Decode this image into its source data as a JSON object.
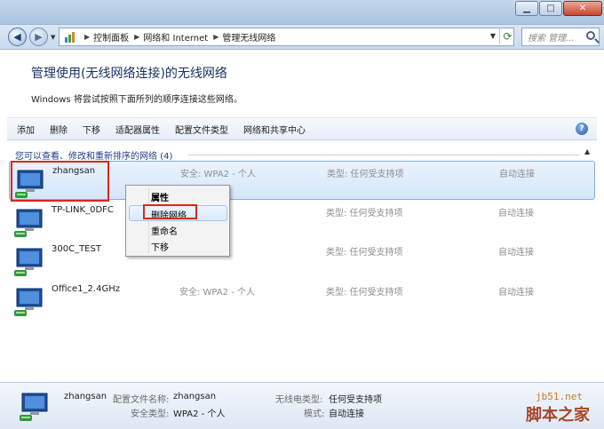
{
  "window": {
    "min_glyph": "▁",
    "max_glyph": "□",
    "close_glyph": "✕"
  },
  "address": {
    "crumbs": [
      "控制面板",
      "网络和 Internet",
      "管理无线网络"
    ],
    "search_placeholder": "搜索 管理..."
  },
  "header": {
    "title": "管理使用(无线网络连接)的无线网络",
    "description": "Windows 将尝试按照下面所列的顺序连接这些网络。"
  },
  "toolbar": {
    "items": [
      "添加",
      "删除",
      "下移",
      "适配器属性",
      "配置文件类型",
      "网络和共享中心"
    ]
  },
  "group": {
    "label": "您可以查看、修改和重新排序的网络 (4)"
  },
  "networks": [
    {
      "name": "zhangsan",
      "security": "安全: WPA2 - 个人",
      "type": "类型: 任何受支持项",
      "mode": "自动连接"
    },
    {
      "name": "TP-LINK_0DFC",
      "security": "",
      "type": "类型: 任何受支持项",
      "mode": "自动连接"
    },
    {
      "name": "300C_TEST",
      "security": "",
      "type": "类型: 任何受支持项",
      "mode": "自动连接"
    },
    {
      "name": "Office1_2.4GHz",
      "security": "安全: WPA2 - 个人",
      "type": "类型: 任何受支持项",
      "mode": "自动连接"
    }
  ],
  "context_menu": {
    "items": [
      "属性",
      "删除网络",
      "重命名",
      "下移"
    ]
  },
  "details": {
    "name": "zhangsan",
    "profile_name_label": "配置文件名称:",
    "profile_name_value": "zhangsan",
    "security_label": "安全类型:",
    "security_value": "WPA2 - 个人",
    "radio_label": "无线电类型:",
    "radio_value": "任何受支持项",
    "mode_label": "模式:",
    "mode_value": "自动连接"
  },
  "watermark": {
    "site": "jb51.net",
    "brand": "脚本之家"
  },
  "colors": {
    "highlight_border": "#d8281e",
    "selection": "#d4e6fb",
    "title": "#1a3262"
  }
}
